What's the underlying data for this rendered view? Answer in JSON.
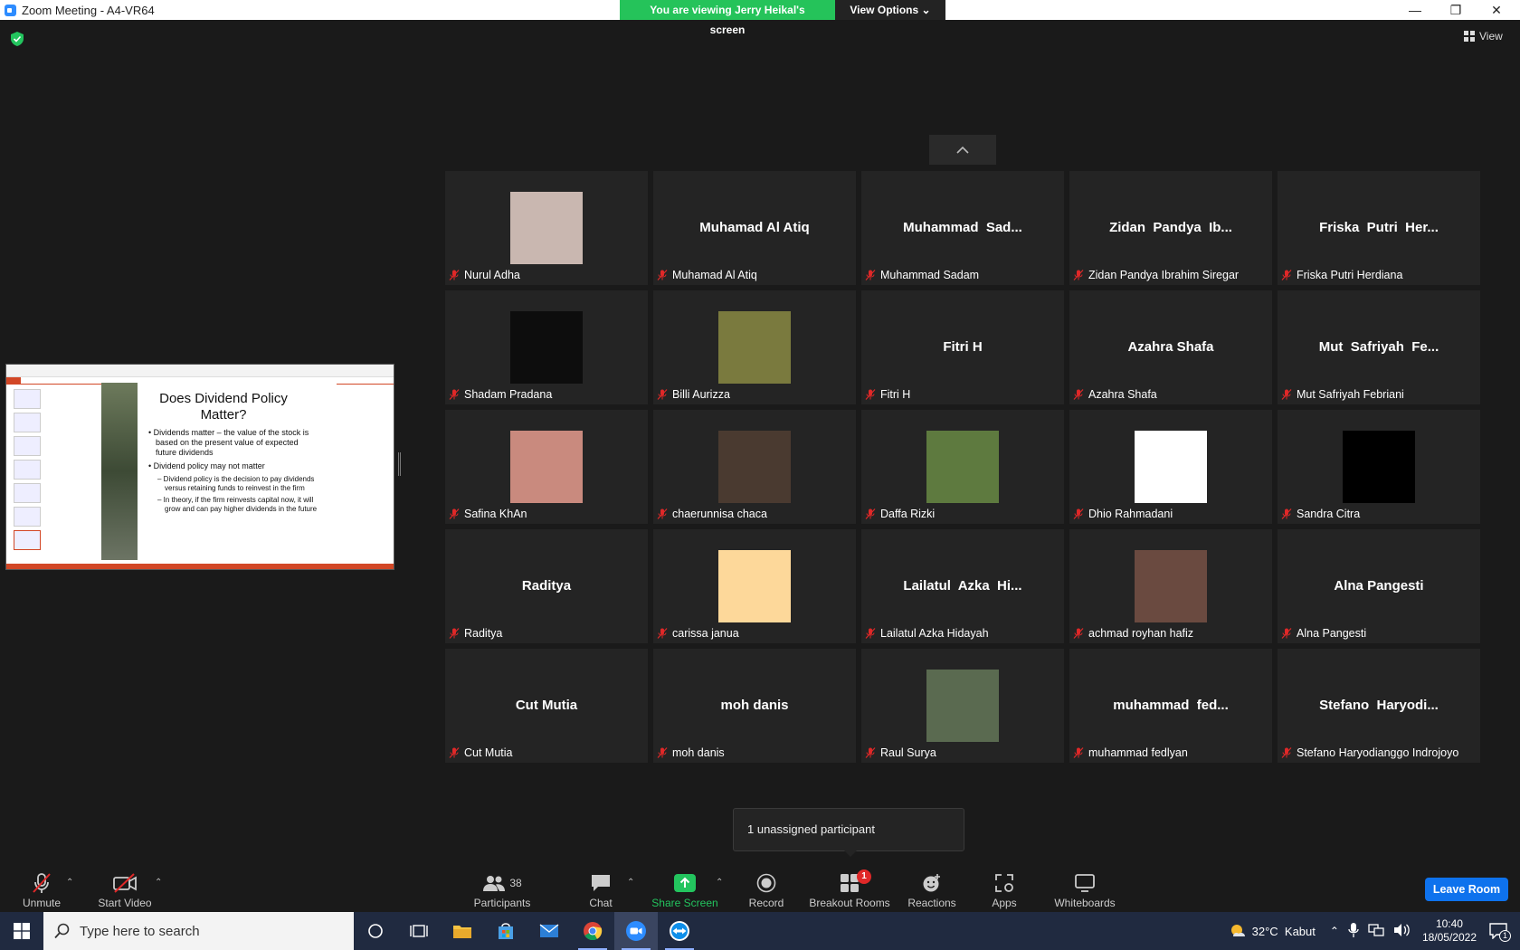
{
  "window": {
    "title": "Zoom Meeting - A4-VR64",
    "viewing_banner": "You are viewing Jerry Heikal's screen",
    "view_options": "View Options",
    "view_label": "View"
  },
  "shared_slide": {
    "title": "Does Dividend Policy Matter?",
    "bullets": [
      "Dividends matter – the value of the stock is based on the present value of expected future dividends",
      "Dividend policy may not matter"
    ],
    "sub_bullets": [
      "Dividend policy is the decision to pay dividends versus retaining funds to reinvest in the firm",
      "In theory, if the firm reinvests capital now, it will grow and can pay higher dividends in the future"
    ]
  },
  "participants": [
    {
      "label": "Nurul Adha",
      "display": "",
      "avatar": "photo",
      "color": "#c9b7b0"
    },
    {
      "label": "Muhamad Al Atiq",
      "display": "Muhamad Al Atiq",
      "avatar": "none",
      "color": ""
    },
    {
      "label": "Muhammad Sadam",
      "display": "Muhammad  Sad...",
      "avatar": "none",
      "color": ""
    },
    {
      "label": "Zidan Pandya Ibrahim Siregar",
      "display": "Zidan  Pandya  Ib...",
      "avatar": "none",
      "color": ""
    },
    {
      "label": "Friska Putri Herdiana",
      "display": "Friska  Putri  Her...",
      "avatar": "none",
      "color": ""
    },
    {
      "label": "Shadam Pradana",
      "display": "",
      "avatar": "photo",
      "color": "#0d0d0d"
    },
    {
      "label": "Billi Aurizza",
      "display": "",
      "avatar": "photo",
      "color": "#7a7a3e"
    },
    {
      "label": "Fitri H",
      "display": "Fitri H",
      "avatar": "none",
      "color": ""
    },
    {
      "label": "Azahra Shafa",
      "display": "Azahra Shafa",
      "avatar": "none",
      "color": ""
    },
    {
      "label": "Mut Safriyah Febriani",
      "display": "Mut  Safriyah  Fe...",
      "avatar": "none",
      "color": ""
    },
    {
      "label": "Safina KhAn",
      "display": "",
      "avatar": "photo",
      "color": "#c98a7e"
    },
    {
      "label": "chaerunnisa chaca",
      "display": "",
      "avatar": "photo",
      "color": "#4a3a30"
    },
    {
      "label": "Daffa Rizki",
      "display": "",
      "avatar": "photo",
      "color": "#5e7a3f"
    },
    {
      "label": "Dhio Rahmadani",
      "display": "",
      "avatar": "photo",
      "color": "#ffffff"
    },
    {
      "label": "Sandra Citra",
      "display": "",
      "avatar": "photo",
      "color": "#000000"
    },
    {
      "label": "Raditya",
      "display": "Raditya",
      "avatar": "none",
      "color": ""
    },
    {
      "label": "carissa janua",
      "display": "",
      "avatar": "photo",
      "color": "#fdd89a"
    },
    {
      "label": "Lailatul Azka Hidayah",
      "display": "Lailatul  Azka  Hi...",
      "avatar": "none",
      "color": ""
    },
    {
      "label": "achmad royhan hafiz",
      "display": "",
      "avatar": "photo",
      "color": "#6a4a40"
    },
    {
      "label": "Alna Pangesti",
      "display": "Alna Pangesti",
      "avatar": "none",
      "color": ""
    },
    {
      "label": "Cut Mutia",
      "display": "Cut Mutia",
      "avatar": "none",
      "color": ""
    },
    {
      "label": "moh danis",
      "display": "moh danis",
      "avatar": "none",
      "color": ""
    },
    {
      "label": "Raul Surya",
      "display": "",
      "avatar": "photo",
      "color": "#5a6a50"
    },
    {
      "label": "muhammad fedlyan",
      "display": "muhammad  fed...",
      "avatar": "none",
      "color": ""
    },
    {
      "label": "Stefano Haryodianggo Indrojoyo",
      "display": "Stefano  Haryodi...",
      "avatar": "none",
      "color": ""
    }
  ],
  "unassigned": "1 unassigned participant",
  "toolbar": {
    "unmute": "Unmute",
    "start_video": "Start Video",
    "participants": "Participants",
    "participants_count": "38",
    "chat": "Chat",
    "share_screen": "Share Screen",
    "record": "Record",
    "breakout_rooms": "Breakout Rooms",
    "breakout_badge": "1",
    "reactions": "Reactions",
    "apps": "Apps",
    "whiteboards": "Whiteboards",
    "leave": "Leave Room"
  },
  "taskbar": {
    "search_placeholder": "Type here to search",
    "weather": "32°C  Kabut",
    "time": "10:40",
    "date": "18/05/2022",
    "notification_count": "1"
  },
  "colors": {
    "share_green": "#25c35a",
    "leave_blue": "#0e72ed",
    "mic_red": "#e02828"
  }
}
